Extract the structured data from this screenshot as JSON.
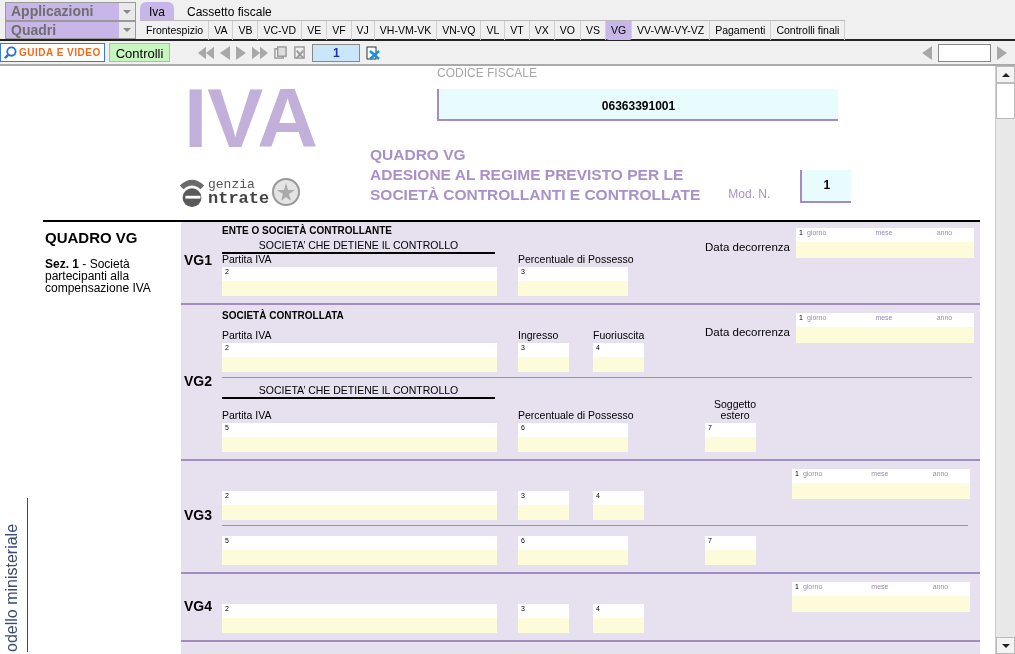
{
  "app_menu": {
    "applications": "Applicazioni",
    "sections": "Quadri"
  },
  "top_tabs": [
    {
      "label": "Iva",
      "selected": true
    },
    {
      "label": "Cassetto fiscale",
      "selected": false
    }
  ],
  "quadri_tabs": [
    {
      "label": "Frontespizio",
      "selected": false
    },
    {
      "label": "VA",
      "selected": false
    },
    {
      "label": "VB",
      "selected": false
    },
    {
      "label": "VC-VD",
      "selected": false
    },
    {
      "label": "VE",
      "selected": false
    },
    {
      "label": "VF",
      "selected": false
    },
    {
      "label": "VJ",
      "selected": false
    },
    {
      "label": "VH-VM-VK",
      "selected": false
    },
    {
      "label": "VN-VQ",
      "selected": false
    },
    {
      "label": "VL",
      "selected": false
    },
    {
      "label": "VT",
      "selected": false
    },
    {
      "label": "VX",
      "selected": false
    },
    {
      "label": "VO",
      "selected": false
    },
    {
      "label": "VS",
      "selected": false
    },
    {
      "label": "VG",
      "selected": true
    },
    {
      "label": "VV-VW-VY-VZ",
      "selected": false
    },
    {
      "label": "Pagamenti",
      "selected": false
    },
    {
      "label": "Controlli finali",
      "selected": false
    }
  ],
  "toolbar": {
    "guide_button": "GUIDA E VIDEO",
    "check_button": "Controlli",
    "page_number": "1"
  },
  "form": {
    "logo": {
      "letters": "IVA",
      "agency_top": "genzia",
      "agency_bottom": "ntrate"
    },
    "tax_code": {
      "label": "CODICE FISCALE",
      "value": "06363391001"
    },
    "title_lines": [
      "QUADRO VG",
      "ADESIONE AL REGIME PREVISTO PER LE",
      "SOCIETÀ CONTROLLANTI E CONTROLLATE"
    ],
    "module": {
      "label": "Mod. N.",
      "value": "1"
    },
    "section": {
      "title": "QUADRO VG",
      "description": "**Sez. 1** - Società partecipanti alla compensazione IVA"
    },
    "side_label": "odello ministeriale",
    "rows": [
      {
        "code": "VG1",
        "blocks": [
          {
            "heading": "ENTE O SOCIETÀ CONTROLLANTE",
            "subheading": "SOCIETA’ CHE DETIENE IL CONTROLLO",
            "date": {
              "label": "Data decorrenza",
              "number": "1",
              "parts": [
                "giorno",
                "mese",
                "anno"
              ]
            },
            "fields": [
              {
                "label": "Partita IVA",
                "number": "2",
                "kind": "wide"
              },
              {
                "label": "Percentuale di Possesso",
                "number": "3",
                "kind": "medium"
              }
            ]
          }
        ]
      },
      {
        "code": "VG2",
        "blocks": [
          {
            "heading": "SOCIETÀ CONTROLLATA",
            "date": {
              "label": "Data decorrenza",
              "number": "1",
              "parts": [
                "giorno",
                "mese",
                "anno"
              ]
            },
            "fields": [
              {
                "label": "Partita IVA",
                "number": "2",
                "kind": "wide"
              },
              {
                "label": "Ingresso",
                "number": "3",
                "kind": "small"
              },
              {
                "label": "Fuoriuscita",
                "number": "4",
                "kind": "small"
              }
            ]
          },
          {
            "subheading": "SOCIETA’ CHE DETIENE IL CONTROLLO",
            "fields": [
              {
                "label": "Partita IVA",
                "number": "5",
                "kind": "wide"
              },
              {
                "label": "Percentuale di Possesso",
                "number": "6",
                "kind": "medium"
              },
              {
                "label": "Soggetto estero",
                "number": "7",
                "kind": "small"
              }
            ]
          }
        ]
      },
      {
        "code": "VG3",
        "blocks": [
          {
            "date": {
              "number": "1",
              "parts": [
                "giorno",
                "mese",
                "anno"
              ]
            },
            "fields": [
              {
                "number": "2",
                "kind": "wide"
              },
              {
                "number": "3",
                "kind": "small"
              },
              {
                "number": "4",
                "kind": "small"
              }
            ]
          },
          {
            "fields": [
              {
                "number": "5",
                "kind": "wide"
              },
              {
                "number": "6",
                "kind": "medium"
              },
              {
                "number": "7",
                "kind": "small"
              }
            ]
          }
        ]
      },
      {
        "code": "VG4",
        "blocks": [
          {
            "date": {
              "number": "1",
              "parts": [
                "giorno",
                "mese",
                "anno"
              ]
            },
            "fields": [
              {
                "number": "2",
                "kind": "wide"
              },
              {
                "number": "3",
                "kind": "small"
              },
              {
                "number": "4",
                "kind": "small"
              }
            ]
          }
        ]
      }
    ]
  }
}
